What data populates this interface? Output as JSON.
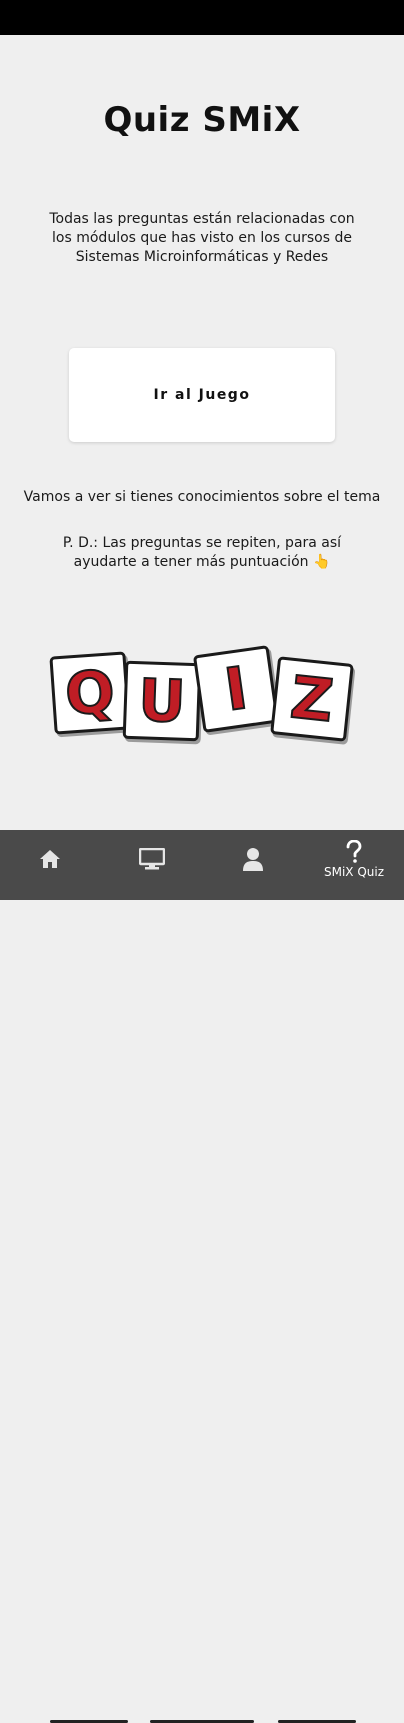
{
  "app": {
    "title": "Quiz SMiX",
    "intro": "Todas las preguntas están relacionadas con los módulos que has visto en los cursos de Sistemas Microinformáticas y Redes",
    "game_button_label": "Ir al Juego",
    "tagline": "Vamos a ver si tienes conocimientos sobre el tema",
    "note": "P. D.: Las preguntas se repiten, para así ayudarte a tener más puntuación 👆"
  },
  "logo": {
    "letters": [
      "Q",
      "U",
      "I",
      "Z"
    ]
  },
  "bottom_nav": {
    "items": [
      {
        "icon": "home-icon",
        "label": ""
      },
      {
        "icon": "monitor-icon",
        "label": ""
      },
      {
        "icon": "person-icon",
        "label": ""
      },
      {
        "icon": "question-icon",
        "label": "SMiX Quiz"
      }
    ],
    "active_index": 3
  },
  "colors": {
    "background": "#efefef",
    "accent_red": "#c01d25",
    "nav_background": "#4a4a4a"
  }
}
